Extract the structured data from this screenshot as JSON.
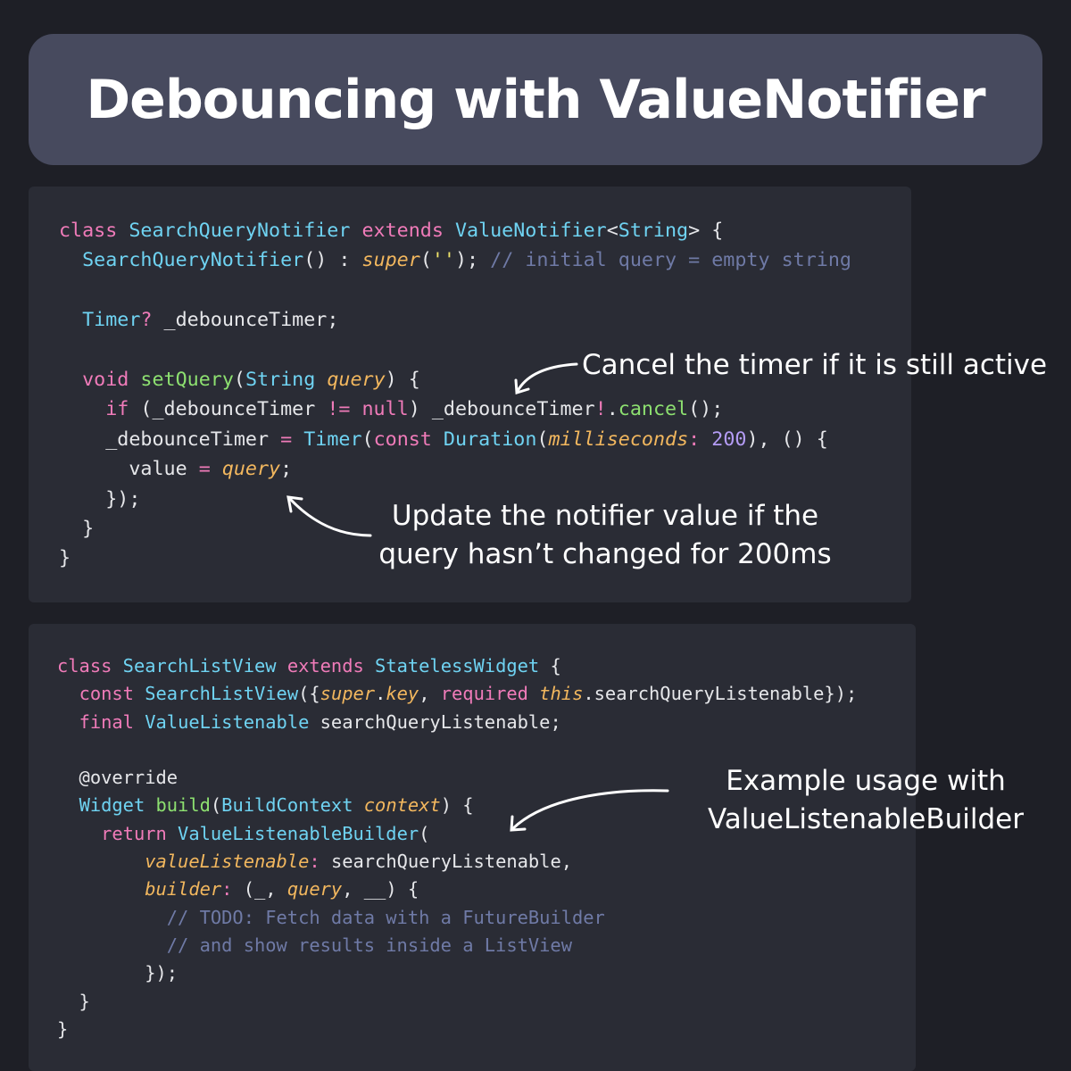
{
  "title": "Debouncing with ValueNotifier",
  "code_block_1": {
    "lines": [
      [
        [
          "k",
          "class "
        ],
        [
          "t",
          "SearchQueryNotifier "
        ],
        [
          "k",
          "extends "
        ],
        [
          "t",
          "ValueNotifier"
        ],
        [
          "w",
          "<"
        ],
        [
          "t",
          "String"
        ],
        [
          "w",
          "> {"
        ]
      ],
      [
        [
          "w",
          "  "
        ],
        [
          "t",
          "SearchQueryNotifier"
        ],
        [
          "w",
          "() : "
        ],
        [
          "i",
          "super"
        ],
        [
          "w",
          "("
        ],
        [
          "s",
          "''"
        ],
        [
          "w",
          "); "
        ],
        [
          "c",
          "// initial query = empty string"
        ]
      ],
      [],
      [
        [
          "w",
          "  "
        ],
        [
          "t",
          "Timer"
        ],
        [
          "o",
          "? "
        ],
        [
          "w",
          "_debounceTimer;"
        ]
      ],
      [],
      [
        [
          "w",
          "  "
        ],
        [
          "k",
          "void "
        ],
        [
          "f",
          "setQuery"
        ],
        [
          "w",
          "("
        ],
        [
          "t",
          "String "
        ],
        [
          "p",
          "query"
        ],
        [
          "w",
          ") {"
        ]
      ],
      [
        [
          "w",
          "    "
        ],
        [
          "k",
          "if "
        ],
        [
          "w",
          "(_debounceTimer "
        ],
        [
          "o",
          "!= "
        ],
        [
          "k",
          "null"
        ],
        [
          "w",
          ") _debounceTimer"
        ],
        [
          "o",
          "!"
        ],
        [
          "w",
          "."
        ],
        [
          "f",
          "cancel"
        ],
        [
          "w",
          "();"
        ]
      ],
      [
        [
          "w",
          "    _debounceTimer "
        ],
        [
          "o",
          "= "
        ],
        [
          "t",
          "Timer"
        ],
        [
          "w",
          "("
        ],
        [
          "k",
          "const "
        ],
        [
          "t",
          "Duration"
        ],
        [
          "w",
          "("
        ],
        [
          "p",
          "milliseconds"
        ],
        [
          "o",
          ": "
        ],
        [
          "n",
          "200"
        ],
        [
          "w",
          "), () {"
        ]
      ],
      [
        [
          "w",
          "      value "
        ],
        [
          "o",
          "= "
        ],
        [
          "p",
          "query"
        ],
        [
          "w",
          ";"
        ]
      ],
      [
        [
          "w",
          "    });"
        ]
      ],
      [
        [
          "w",
          "  }"
        ]
      ],
      [
        [
          "w",
          "}"
        ]
      ]
    ]
  },
  "code_block_2": {
    "lines": [
      [
        [
          "k",
          "class "
        ],
        [
          "t",
          "SearchListView "
        ],
        [
          "k",
          "extends "
        ],
        [
          "t",
          "StatelessWidget "
        ],
        [
          "w",
          "{"
        ]
      ],
      [
        [
          "w",
          "  "
        ],
        [
          "k",
          "const "
        ],
        [
          "t",
          "SearchListView"
        ],
        [
          "w",
          "({"
        ],
        [
          "i",
          "super"
        ],
        [
          "w",
          "."
        ],
        [
          "p",
          "key"
        ],
        [
          "w",
          ", "
        ],
        [
          "k",
          "required "
        ],
        [
          "i",
          "this"
        ],
        [
          "w",
          ".searchQueryListenable});"
        ]
      ],
      [
        [
          "w",
          "  "
        ],
        [
          "k",
          "final "
        ],
        [
          "t",
          "ValueListenable "
        ],
        [
          "w",
          "searchQueryListenable;"
        ]
      ],
      [],
      [
        [
          "w",
          "  @override"
        ]
      ],
      [
        [
          "w",
          "  "
        ],
        [
          "t",
          "Widget "
        ],
        [
          "f",
          "build"
        ],
        [
          "w",
          "("
        ],
        [
          "t",
          "BuildContext "
        ],
        [
          "p",
          "context"
        ],
        [
          "w",
          ") {"
        ]
      ],
      [
        [
          "w",
          "    "
        ],
        [
          "k",
          "return "
        ],
        [
          "t",
          "ValueListenableBuilder"
        ],
        [
          "w",
          "("
        ]
      ],
      [
        [
          "w",
          "        "
        ],
        [
          "p",
          "valueListenable"
        ],
        [
          "o",
          ": "
        ],
        [
          "w",
          "searchQueryListenable,"
        ]
      ],
      [
        [
          "w",
          "        "
        ],
        [
          "p",
          "builder"
        ],
        [
          "o",
          ": "
        ],
        [
          "w",
          "(_, "
        ],
        [
          "p",
          "query"
        ],
        [
          "w",
          ", __) {"
        ]
      ],
      [
        [
          "c",
          "          // TODO: Fetch data with a FutureBuilder"
        ]
      ],
      [
        [
          "c",
          "          // and show results inside a ListView"
        ]
      ],
      [
        [
          "w",
          "        });"
        ]
      ],
      [
        [
          "w",
          "  }"
        ]
      ],
      [
        [
          "w",
          "}"
        ]
      ]
    ]
  },
  "annotations": {
    "cancel": "Cancel the timer if it is still active",
    "update_line1": "Update the notifier value if the",
    "update_line2": "query hasn’t changed for 200ms",
    "example_line1": "Example usage with",
    "example_line2": "ValueListenableBuilder"
  },
  "colors": {
    "background": "#1e1f26",
    "title_bar": "#474a5e",
    "panel": "#2a2c35",
    "keyword": "#f07bb9",
    "type": "#6fd3f2",
    "function": "#8de070",
    "parameter": "#f2b75e",
    "comment": "#6f7aa6",
    "string": "#efe36a",
    "number": "#b49cf5"
  }
}
